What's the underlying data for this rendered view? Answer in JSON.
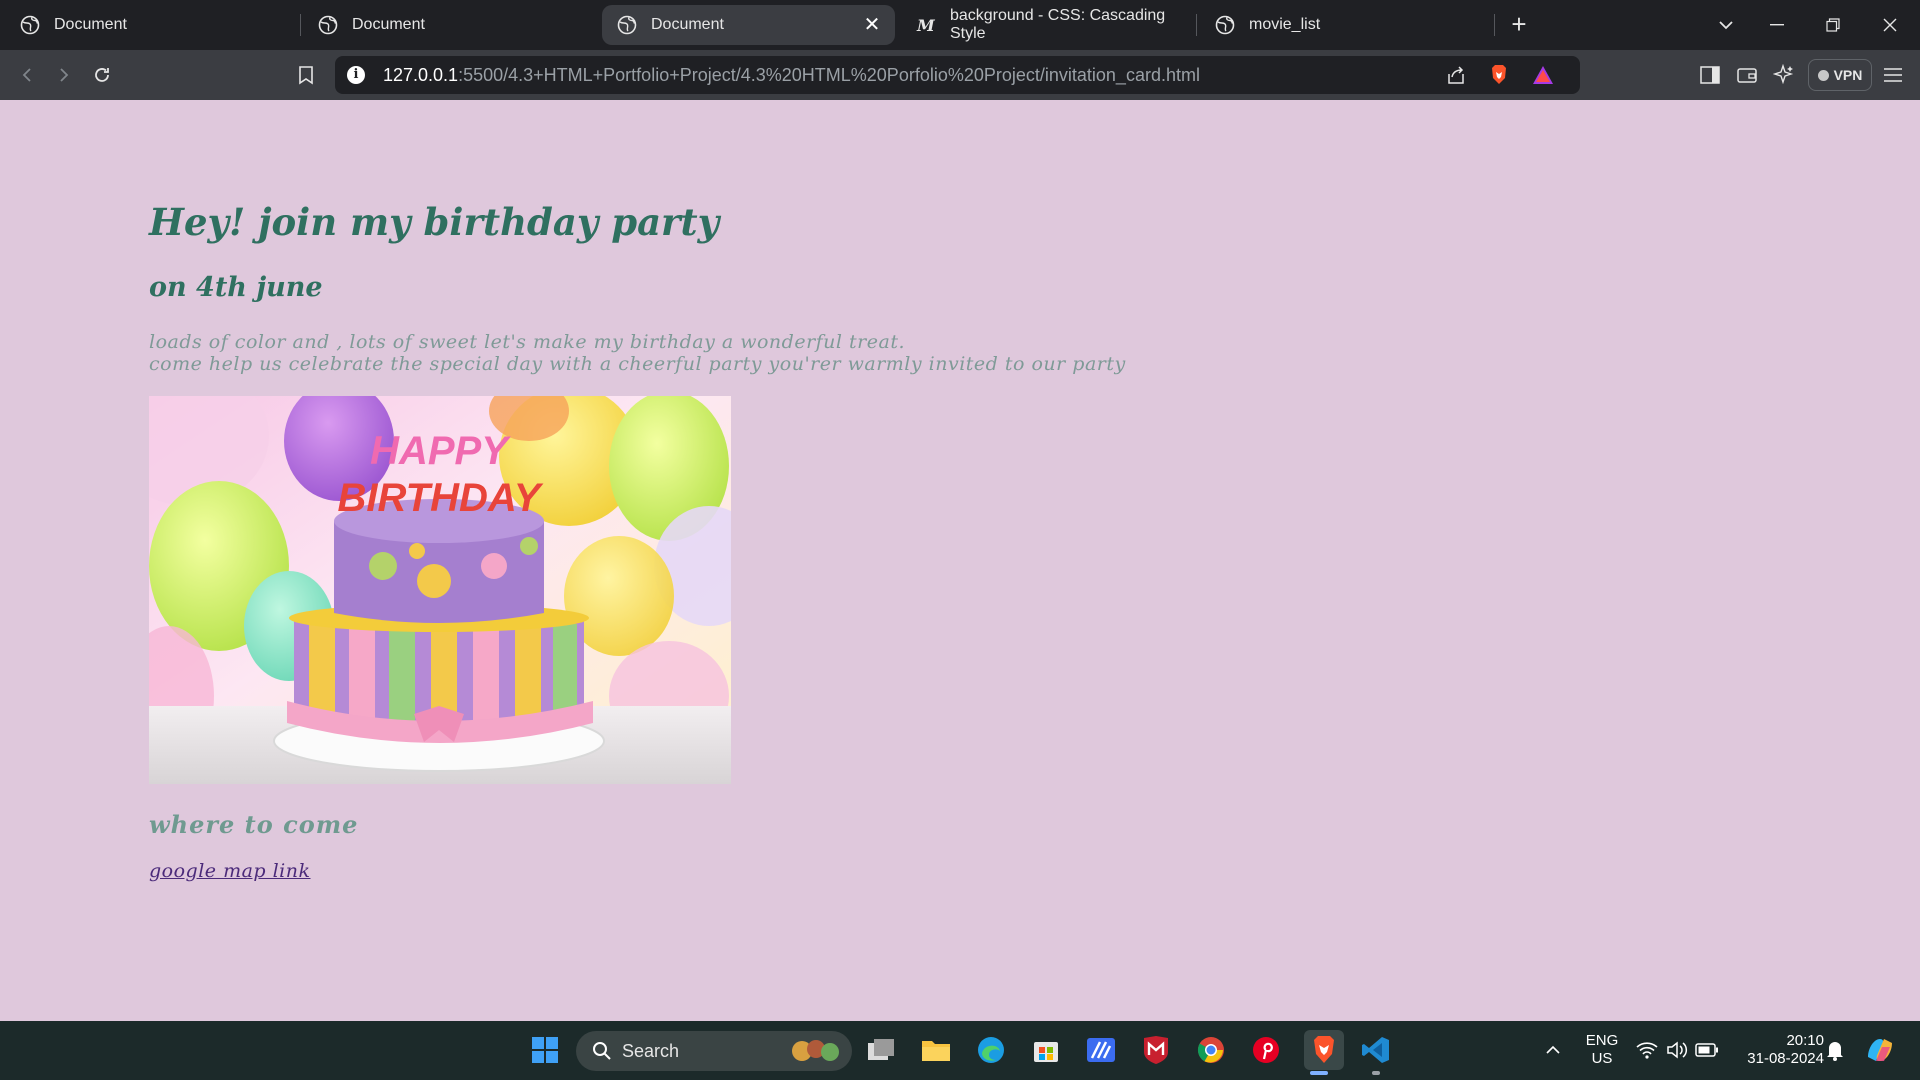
{
  "browser": {
    "tabs": [
      {
        "title": "Document",
        "active": false
      },
      {
        "title": "Document",
        "active": false
      },
      {
        "title": "Document",
        "active": true
      },
      {
        "title": "background - CSS: Cascading Style",
        "active": false
      },
      {
        "title": "movie_list",
        "active": false
      }
    ],
    "url_host": "127.0.0.1",
    "url_path": ":5500/4.3+HTML+Portfolio+Project/4.3%20HTML%20Porfolio%20Project/invitation_card.html",
    "vpn_label": "VPN"
  },
  "page": {
    "heading": "Hey! join my birthday party",
    "date": "on 4th june",
    "paragraph_line1": "loads of color and , lots of sweet let's make my birthday a wonderful treat.",
    "paragraph_line2": "come help us celebrate the special day with a cheerful party you'rer warmly invited to our party",
    "image_text_top": "HAPPY",
    "image_text_bottom": "BIRTHDAY",
    "where_heading": "where to come",
    "map_link": "google map link",
    "colors": {
      "background": "#dfc8dc",
      "heading": "#2f7060",
      "paragraph": "#7f9a97",
      "link": "#4b2a7a"
    }
  },
  "taskbar": {
    "search_label": "Search",
    "language_line1": "ENG",
    "language_line2": "US",
    "time": "20:10",
    "date": "31-08-2024",
    "apps": [
      "windows-start",
      "task-view",
      "file-explorer",
      "edge",
      "microsoft-store",
      "vscode-insiders-like",
      "mcafee",
      "chrome",
      "pinterest",
      "brave",
      "vscode"
    ]
  }
}
